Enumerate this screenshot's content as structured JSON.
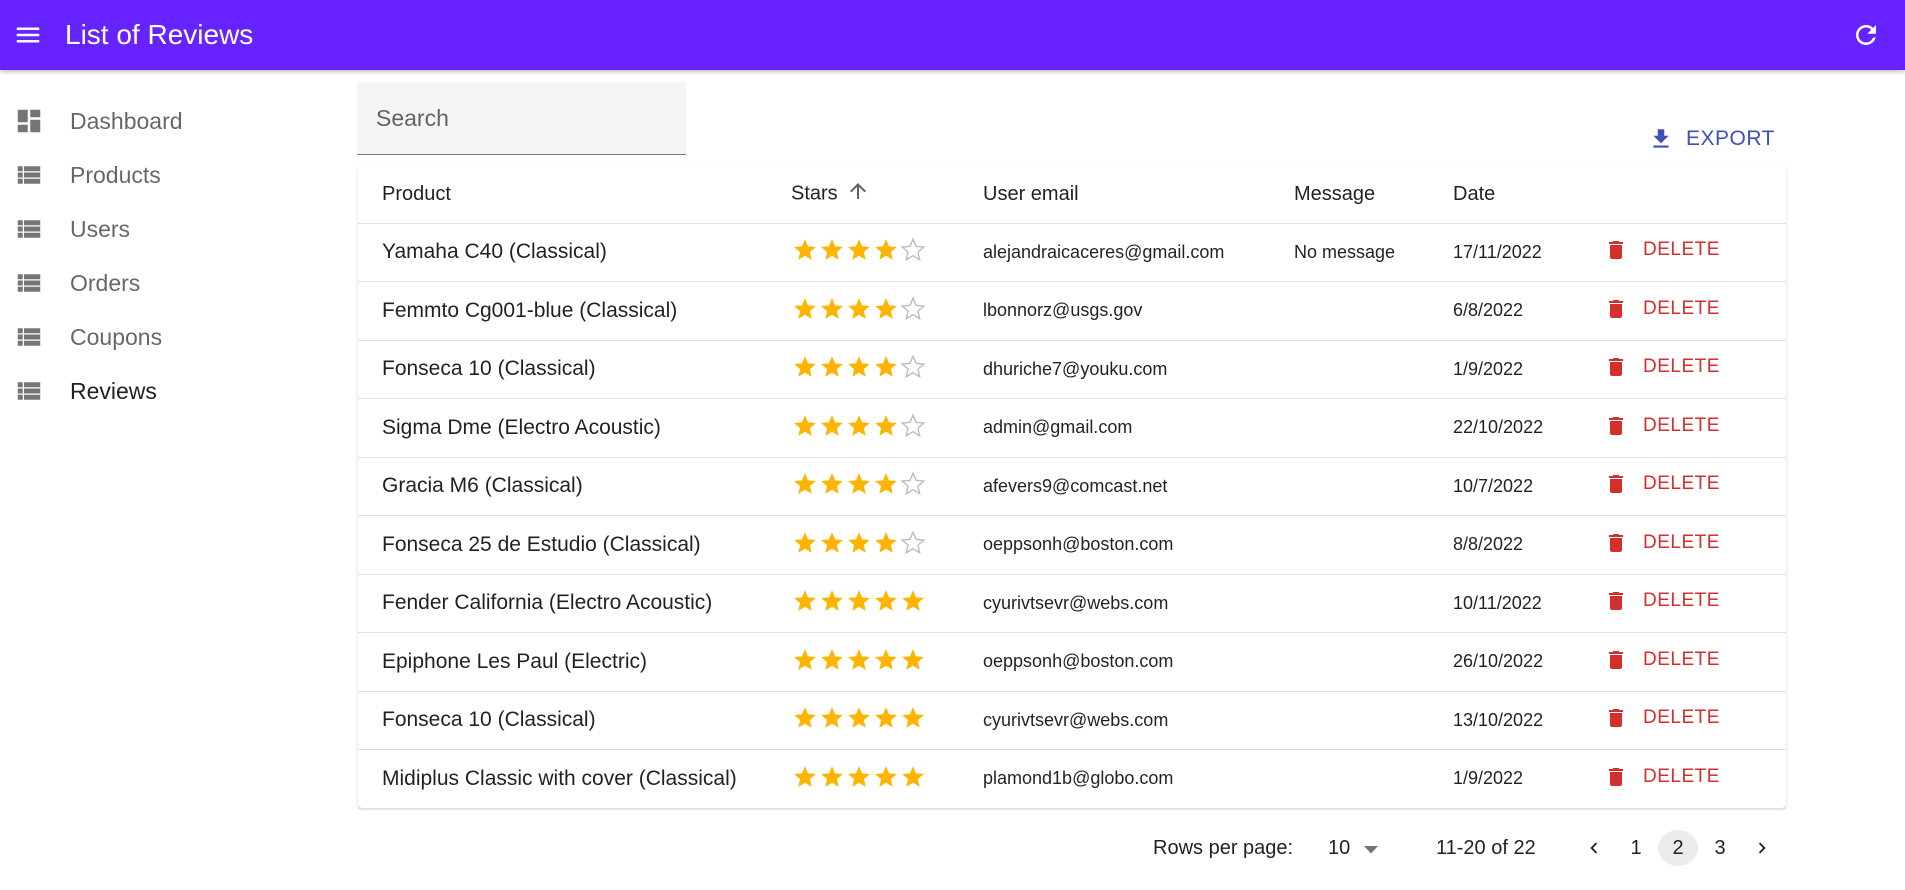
{
  "appbar": {
    "title": "List of Reviews",
    "color": "#6623ff",
    "menu_icon": "hamburger-menu-icon",
    "refresh_icon": "refresh-icon"
  },
  "sidebar": {
    "items": [
      {
        "label": "Dashboard",
        "icon": "dashboard-icon",
        "active": false
      },
      {
        "label": "Products",
        "icon": "list-icon",
        "active": false
      },
      {
        "label": "Users",
        "icon": "list-icon",
        "active": false
      },
      {
        "label": "Orders",
        "icon": "list-icon",
        "active": false
      },
      {
        "label": "Coupons",
        "icon": "list-icon",
        "active": false
      },
      {
        "label": "Reviews",
        "icon": "list-icon",
        "active": true
      }
    ]
  },
  "search": {
    "placeholder": "Search",
    "value": ""
  },
  "export": {
    "label": "EXPORT",
    "icon": "download-icon",
    "color": "#3f51b5"
  },
  "table": {
    "columns": [
      "Product",
      "Stars",
      "User email",
      "Message",
      "Date"
    ],
    "sort": {
      "column": "Stars",
      "direction": "ascending"
    },
    "delete_label": "DELETE",
    "delete_color": "#d32f2f",
    "star_color": "#ffb400",
    "rows": [
      {
        "product": "Yamaha C40 (Classical)",
        "stars": 4,
        "email": "alejandraicaceres@gmail.com",
        "message": "No message",
        "date": "17/11/2022"
      },
      {
        "product": "Femmto Cg001-blue (Classical)",
        "stars": 4,
        "email": "lbonnorz@usgs.gov",
        "message": "",
        "date": "6/8/2022"
      },
      {
        "product": "Fonseca 10 (Classical)",
        "stars": 4,
        "email": "dhuriche7@youku.com",
        "message": "",
        "date": "1/9/2022"
      },
      {
        "product": "Sigma Dme (Electro Acoustic)",
        "stars": 4,
        "email": "admin@gmail.com",
        "message": "",
        "date": "22/10/2022"
      },
      {
        "product": "Gracia M6 (Classical)",
        "stars": 4,
        "email": "afevers9@comcast.net",
        "message": "",
        "date": "10/7/2022"
      },
      {
        "product": "Fonseca 25 de Estudio (Classical)",
        "stars": 4,
        "email": "oeppsonh@boston.com",
        "message": "",
        "date": "8/8/2022"
      },
      {
        "product": "Fender California (Electro Acoustic)",
        "stars": 5,
        "email": "cyurivtsevr@webs.com",
        "message": "",
        "date": "10/11/2022"
      },
      {
        "product": "Epiphone Les Paul (Electric)",
        "stars": 5,
        "email": "oeppsonh@boston.com",
        "message": "",
        "date": "26/10/2022"
      },
      {
        "product": "Fonseca 10 (Classical)",
        "stars": 5,
        "email": "cyurivtsevr@webs.com",
        "message": "",
        "date": "13/10/2022"
      },
      {
        "product": "Midiplus Classic with cover (Classical)",
        "stars": 5,
        "email": "plamond1b@globo.com",
        "message": "",
        "date": "1/9/2022"
      }
    ]
  },
  "pagination": {
    "rows_per_page_label": "Rows per page:",
    "rows_per_page": "10",
    "range": "11-20 of 22",
    "pages": [
      "1",
      "2",
      "3"
    ],
    "current_page": "2"
  }
}
